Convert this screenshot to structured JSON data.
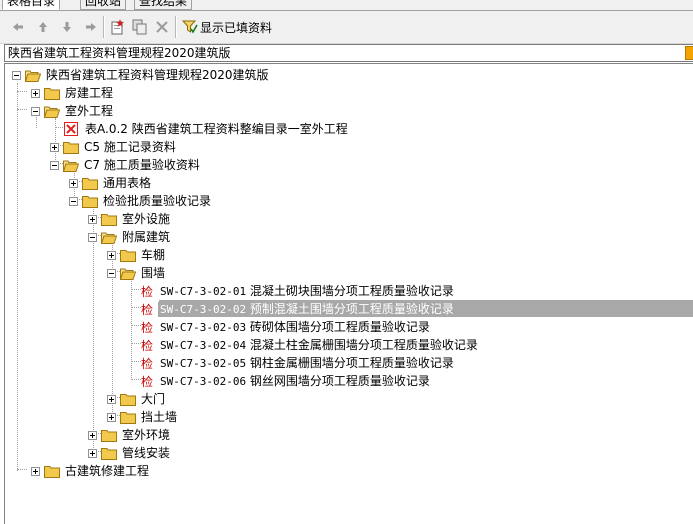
{
  "tabs": [
    "表格目录",
    "回收站",
    "查找结果"
  ],
  "toolbar": {
    "show_filled_label": "显示已填资料"
  },
  "combo": {
    "value": "陕西省建筑工程资料管理规程2020建筑版"
  },
  "colors": {
    "folder": "#f2c94c",
    "selection": "#a8a8a8",
    "check_mark": "#c80000",
    "red_box": "#e02020"
  },
  "tree": {
    "root": "陕西省建筑工程资料管理规程2020建筑版",
    "n_building": "房建工程",
    "n_outdoor": "室外工程",
    "n_table_a02": "表A.0.2 陕西省建筑工程资料整编目录一室外工程",
    "n_c5": "C5 施工记录资料",
    "n_c7": "C7 施工质量验收资料",
    "n_general": "通用表格",
    "n_inspection": "检验批质量验收记录",
    "n_outdoor_facility": "室外设施",
    "n_attached": "附属建筑",
    "n_carport": "车棚",
    "n_wall": "围墙",
    "check_mark": "检",
    "records": [
      {
        "code": "SW-C7-3-02-01",
        "title": "混凝土砌块围墙分项工程质量验收记录"
      },
      {
        "code": "SW-C7-3-02-02",
        "title": "预制混凝土围墙分项工程质量验收记录"
      },
      {
        "code": "SW-C7-3-02-03",
        "title": "砖砌体围墙分项工程质量验收记录"
      },
      {
        "code": "SW-C7-3-02-04",
        "title": "混凝土柱金属栅围墙分项工程质量验收记录"
      },
      {
        "code": "SW-C7-3-02-05",
        "title": "钢柱金属栅围墙分项工程质量验收记录"
      },
      {
        "code": "SW-C7-3-02-06",
        "title": "钢丝网围墙分项工程质量验收记录"
      }
    ],
    "n_gate": "大门",
    "n_retaining": "挡土墙",
    "n_outdoor_env": "室外环境",
    "n_pipeline": "管线安装",
    "n_ancient": "古建筑修建工程"
  }
}
